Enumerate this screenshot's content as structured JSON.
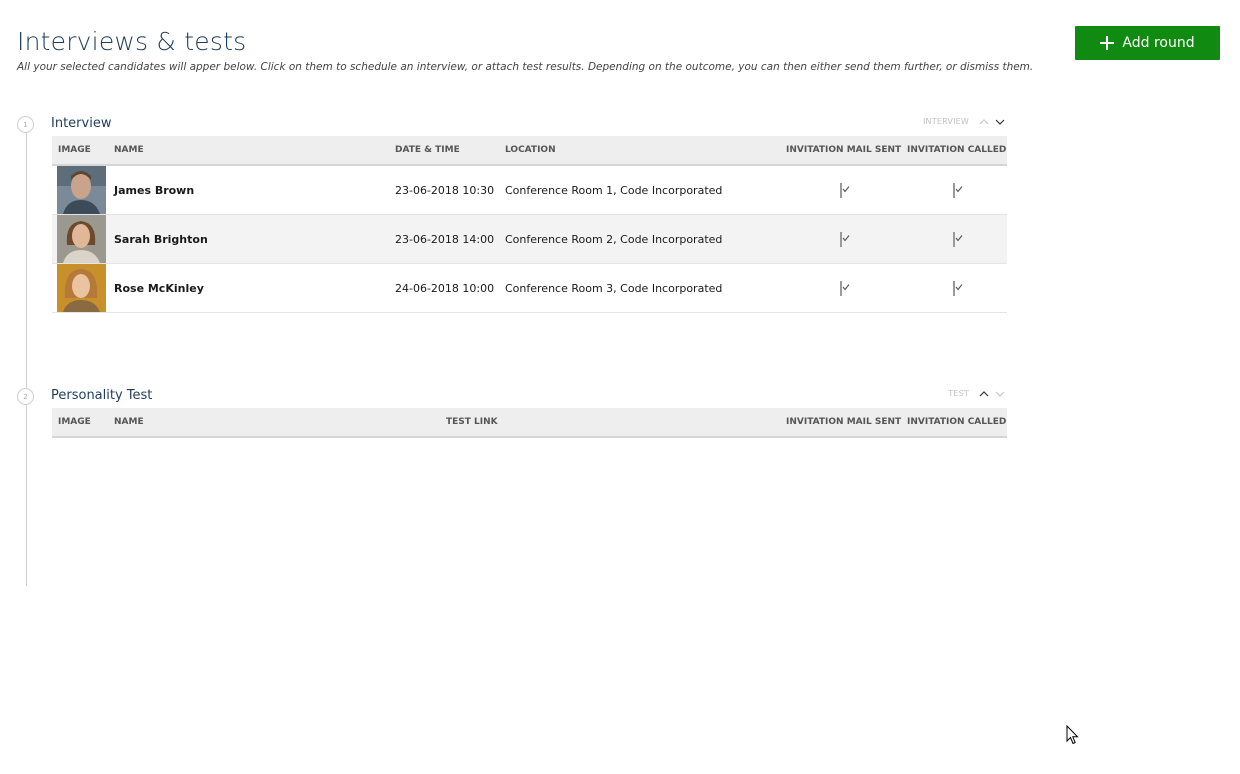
{
  "header": {
    "title": "Interviews & tests",
    "subtitle": "All your selected candidates will apper below. Click on them to schedule an interview, or attach test results. Depending on the outcome, you can then either send them further, or dismiss them.",
    "add_round_label": "Add round",
    "accent_color": "#108a10"
  },
  "rounds": [
    {
      "number": "1",
      "title": "Interview",
      "type_label": "INTERVIEW",
      "columns": {
        "image": "IMAGE",
        "name": "NAME",
        "datetime": "DATE & TIME",
        "location": "LOCATION",
        "mail_sent": "INVITATION MAIL SENT",
        "called": "INVITATION CALLED"
      },
      "rows": [
        {
          "name": "James Brown",
          "datetime": "23-06-2018 10:30",
          "location": "Conference Room 1, Code Incorporated",
          "mail_sent": true,
          "called": true
        },
        {
          "name": "Sarah Brighton",
          "datetime": "23-06-2018 14:00",
          "location": "Conference Room 2, Code Incorporated",
          "mail_sent": true,
          "called": true
        },
        {
          "name": "Rose McKinley",
          "datetime": "24-06-2018 10:00",
          "location": "Conference Room 3, Code Incorporated",
          "mail_sent": true,
          "called": true
        }
      ]
    },
    {
      "number": "2",
      "title": "Personality Test",
      "type_label": "TEST",
      "columns": {
        "image": "IMAGE",
        "name": "NAME",
        "test_link": "TEST LINK",
        "mail_sent": "INVITATION MAIL SENT",
        "called": "INVITATION CALLED"
      },
      "rows": []
    }
  ]
}
